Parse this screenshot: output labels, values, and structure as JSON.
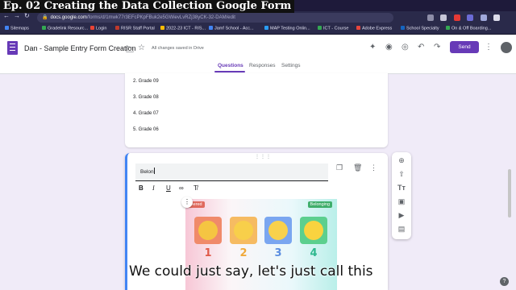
{
  "video_overlay": {
    "title": "Ep. 02 Creating the Data Collection Google Form",
    "caption": "We could just say, let's just call this"
  },
  "browser": {
    "new_tab_label": "+",
    "url_host": "docs.google.com",
    "url_path": "/forms/d/1mwk77r3EFcPKpFBuk2e5GWievLvRZj38yCK-32-DAM/edit",
    "bookmarks": [
      {
        "label": "Sitemaps",
        "color": "#4285f4"
      },
      {
        "label": "Gradelink Resourc...",
        "color": "#34a853"
      },
      {
        "label": "Login",
        "color": "#ea4335"
      },
      {
        "label": "RISR Staff Portal",
        "color": "#c0392b"
      },
      {
        "label": "2022-23 ICT - RIS...",
        "color": "#fbbc04"
      },
      {
        "label": "Jamf School - Acc...",
        "color": "#4285f4"
      },
      {
        "label": "MAP Testing Onlin...",
        "color": "#2a9df4"
      },
      {
        "label": "ICT - Course",
        "color": "#34a853"
      },
      {
        "label": "Adobe Express",
        "color": "#e8453c"
      },
      {
        "label": "School Specialty",
        "color": "#1565c0"
      },
      {
        "label": "On & Off Boarding...",
        "color": "#34a853"
      }
    ]
  },
  "forms": {
    "doc_title": "Dan - Sample Entry Form Creation",
    "saved_status": "All changes saved in Drive",
    "send_label": "Send",
    "tabs": [
      {
        "label": "Questions",
        "active": true
      },
      {
        "label": "Responses",
        "active": false
      },
      {
        "label": "Settings",
        "active": false
      }
    ],
    "options": [
      "2.  Grade 09",
      "3.  Grade 08",
      "4.  Grade 07",
      "5.  Grade 06"
    ],
    "question_text": "Belon",
    "image_tags": {
      "left": "thered",
      "right": "Belonging"
    },
    "emoji_numbers": [
      "1",
      "2",
      "3",
      "4"
    ],
    "emoji_colors": [
      "#e05a4a",
      "#f0a93b",
      "#5b8de0",
      "#2fb88e"
    ],
    "accent_color": "#673ab7",
    "help_label": "?"
  }
}
